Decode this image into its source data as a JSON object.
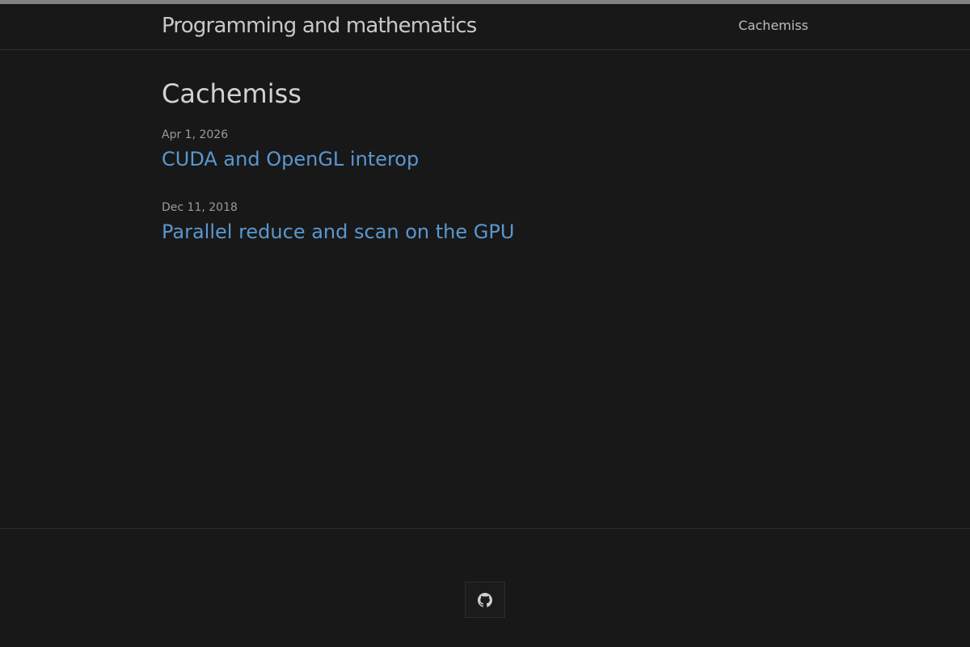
{
  "header": {
    "site_title": "Programming and mathematics",
    "nav": [
      {
        "label": "Cachemiss"
      }
    ]
  },
  "main": {
    "heading": "Cachemiss",
    "posts": [
      {
        "date": "Apr 1, 2026",
        "title": "CUDA and OpenGL interop"
      },
      {
        "date": "Dec 11, 2018",
        "title": "Parallel reduce and scan on the GPU"
      }
    ]
  },
  "footer": {
    "social": [
      {
        "icon": "github-icon"
      }
    ]
  },
  "colors": {
    "background": "#181818",
    "top_bar": "#828282",
    "link": "#5a97d0",
    "text": "#c8c8c8"
  }
}
